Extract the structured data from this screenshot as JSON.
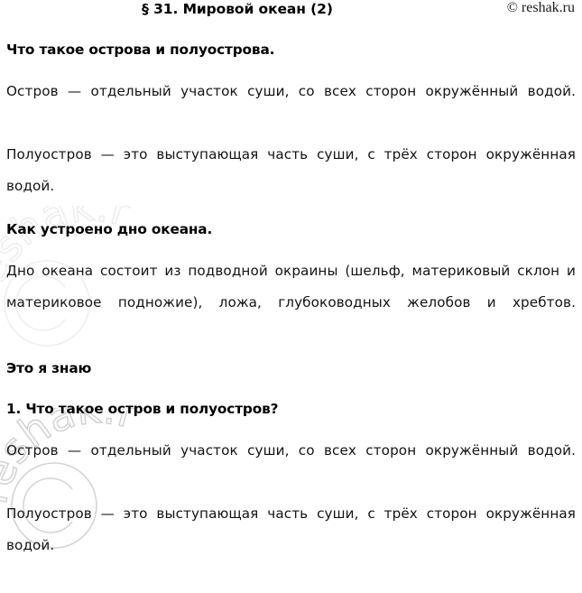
{
  "document": {
    "title": "§ 31. Мировой океан (2)",
    "copyright": "© reshak.ru",
    "watermark_text": "reshak.ru",
    "watermark_symbol": "©",
    "watermark_color": "#d4d4d4",
    "text_color": "#141414",
    "background_color": "#ffffff"
  },
  "sections": [
    {
      "heading": "Что такое острова и полуострова.",
      "paragraphs": [
        "Остров — отдельный участок суши, со всех сторон окружённый водой.",
        "Полуостров — это выступающая часть суши, с трёх сторон окружённая водой."
      ]
    },
    {
      "heading": "Как устроено дно океана.",
      "paragraphs": [
        "Дно океана состоит из подводной окраины (шельф, материковый склон и материковое подножие), ложа, глубоководных желобов и хребтов."
      ]
    },
    {
      "heading": "Это я знаю",
      "paragraphs": []
    },
    {
      "heading": "1. Что такое остров и полуостров?",
      "paragraphs": [
        "Остров — отдельный участок суши, со всех сторон окружённый водой.",
        "Полуостров — это выступающая часть суши, с трёх сторон окружённая водой."
      ]
    }
  ]
}
